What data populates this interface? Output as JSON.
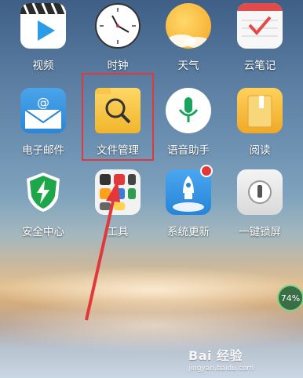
{
  "apps": [
    {
      "label": "视频",
      "icon": "video-play-icon"
    },
    {
      "label": "时钟",
      "icon": "clock-icon"
    },
    {
      "label": "天气",
      "icon": "weather-sun-icon"
    },
    {
      "label": "云笔记",
      "icon": "cloud-notes-icon"
    },
    {
      "label": "电子邮件",
      "icon": "email-icon"
    },
    {
      "label": "文件管理",
      "icon": "file-manager-icon"
    },
    {
      "label": "语音助手",
      "icon": "voice-assistant-icon"
    },
    {
      "label": "阅读",
      "icon": "book-reader-icon"
    },
    {
      "label": "安全中心",
      "icon": "security-shield-icon"
    },
    {
      "label": "工具",
      "icon": "tools-folder-icon"
    },
    {
      "label": "系统更新",
      "icon": "system-update-icon"
    },
    {
      "label": "一键锁屏",
      "icon": "lock-screen-icon"
    }
  ],
  "battery": {
    "percent_label": "74%"
  },
  "watermark": {
    "logo": "Bai 经验",
    "url": "jingyan.baidu.com"
  },
  "colors": {
    "highlight_border": "#e2383a",
    "arrow": "#e2383a"
  }
}
